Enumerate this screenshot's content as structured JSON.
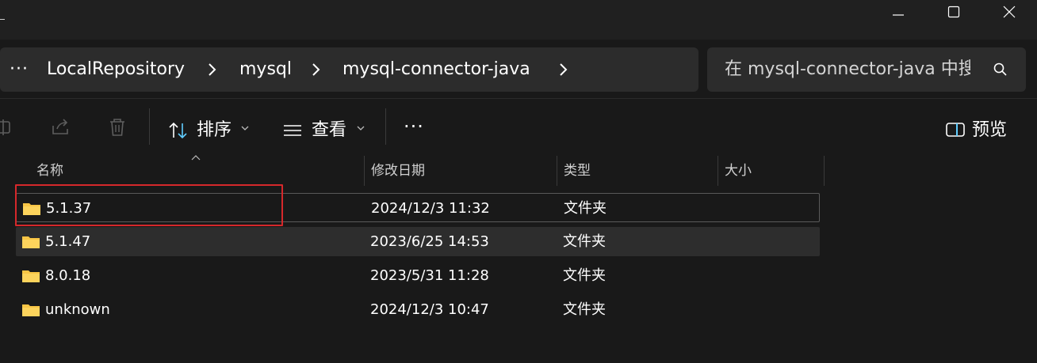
{
  "window": {
    "minimize_icon": "minimize-icon",
    "maximize_icon": "maximize-icon",
    "close_icon": "close-icon"
  },
  "address_bar": {
    "overflow_label": "···",
    "crumbs": [
      "LocalRepository",
      "mysql",
      "mysql-connector-java"
    ]
  },
  "search": {
    "placeholder": "在 mysql-connector-java 中搜索"
  },
  "toolbar": {
    "sort_label": "排序",
    "view_label": "查看",
    "more_label": "···",
    "preview_label": "预览"
  },
  "columns": {
    "name": "名称",
    "modified": "修改日期",
    "type": "类型",
    "size": "大小"
  },
  "files": [
    {
      "name": "5.1.37",
      "modified": "2024/12/3 11:32",
      "type": "文件夹",
      "size": ""
    },
    {
      "name": "5.1.47",
      "modified": "2023/6/25 14:53",
      "type": "文件夹",
      "size": ""
    },
    {
      "name": "8.0.18",
      "modified": "2023/5/31 11:28",
      "type": "文件夹",
      "size": ""
    },
    {
      "name": "unknown",
      "modified": "2024/12/3 10:47",
      "type": "文件夹",
      "size": ""
    }
  ],
  "colors": {
    "background": "#191919",
    "titlebar": "#202020",
    "field": "#2c2c2c",
    "folder": "#f8c545",
    "highlight": "#d6282b",
    "accent": "#60cdff"
  }
}
